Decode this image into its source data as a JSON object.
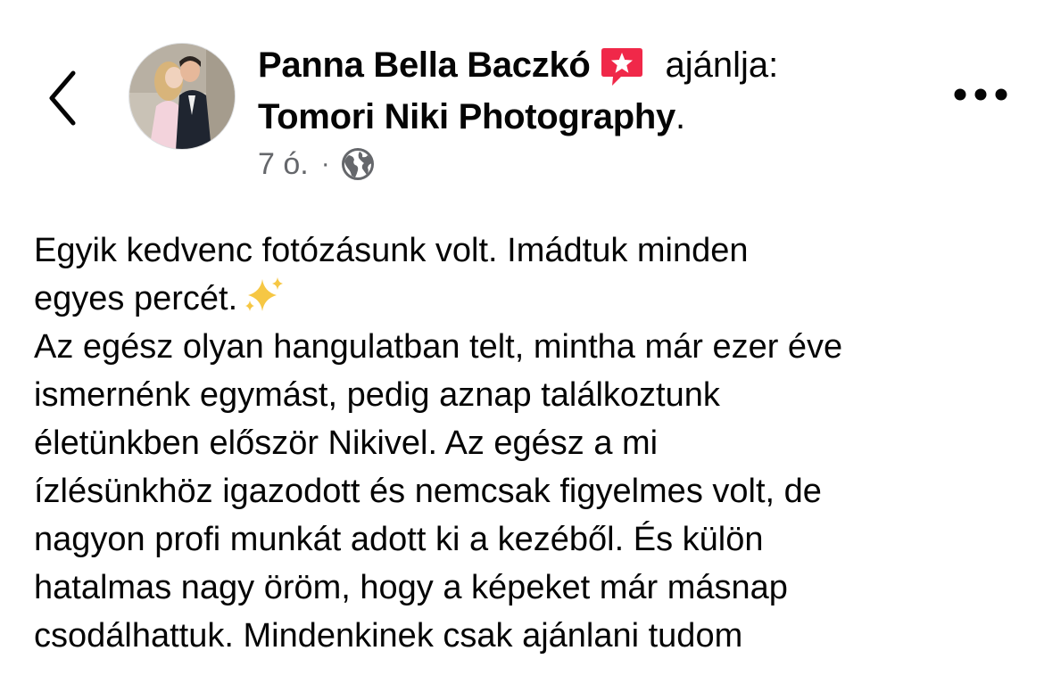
{
  "post": {
    "author": "Panna Bella Baczkó",
    "recommend_verb": "ajánlja:",
    "page_name": "Tomori Niki Photography",
    "page_suffix": ".",
    "time": "7 ó.",
    "separator": "·",
    "audience_icon": "globe-icon",
    "recommend_icon": "recommendation-star-icon",
    "recommend_icon_color": "#f02849",
    "text_lines": [
      "Egyik kedvenc fotózásunk volt. Imádtuk minden",
      "egyes percét.",
      "Az egész olyan hangulatban telt, mintha már ezer éve",
      "ismernénk egymást, pedig aznap találkoztunk",
      "életünkben először Nikivel. Az egész a mi",
      "ízlésünkhöz igazodott és nemcsak figyelmes volt, de",
      "nagyon profi munkát adott ki a kezéből. És külön",
      "hatalmas nagy öröm, hogy a képeket már másnap",
      "csodálhattuk. Mindenkinek csak ajánlani tudom"
    ],
    "emoji_after_line_2": "sparkles-icon"
  },
  "nav": {
    "back_icon": "chevron-left-icon",
    "more_icon": "more-options-icon"
  },
  "colors": {
    "text": "#050505",
    "secondary_text": "#65676b"
  }
}
